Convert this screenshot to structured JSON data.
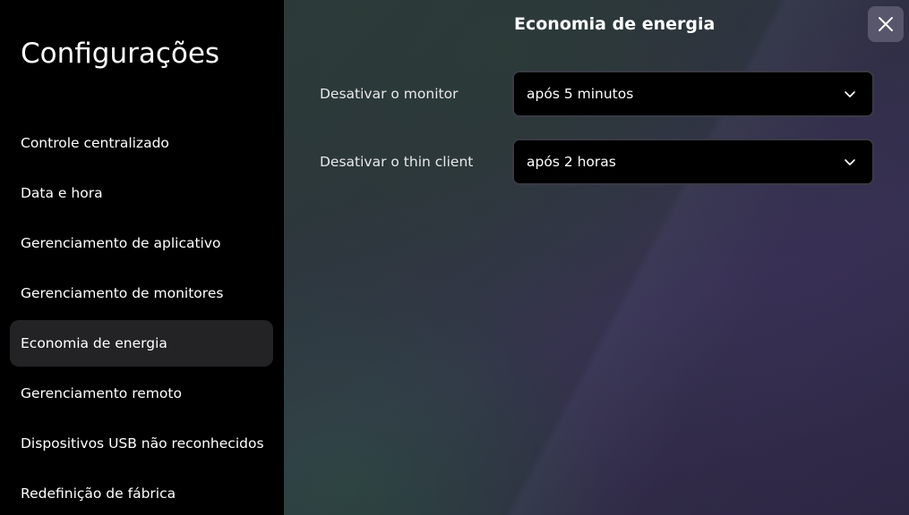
{
  "sidebar": {
    "title": "Configurações",
    "items": [
      {
        "label": "Controle centralizado",
        "active": false
      },
      {
        "label": "Data e hora",
        "active": false
      },
      {
        "label": "Gerenciamento de aplicativo",
        "active": false
      },
      {
        "label": "Gerenciamento de monitores",
        "active": false
      },
      {
        "label": "Economia de energia",
        "active": true
      },
      {
        "label": "Gerenciamento remoto",
        "active": false
      },
      {
        "label": "Dispositivos USB não reconhecidos",
        "active": false
      },
      {
        "label": "Redefinição de fábrica",
        "active": false
      }
    ]
  },
  "panel": {
    "title": "Economia de energia",
    "close_icon": "close-icon",
    "settings": [
      {
        "label": "Desativar o monitor",
        "value": "após 5 minutos"
      },
      {
        "label": "Desativar o thin client",
        "value": "após 2 horas"
      }
    ]
  },
  "colors": {
    "sidebar_bg": "#000000",
    "active_item_bg": "#232325",
    "select_bg": "#000000",
    "select_border": "#3a3a45"
  }
}
